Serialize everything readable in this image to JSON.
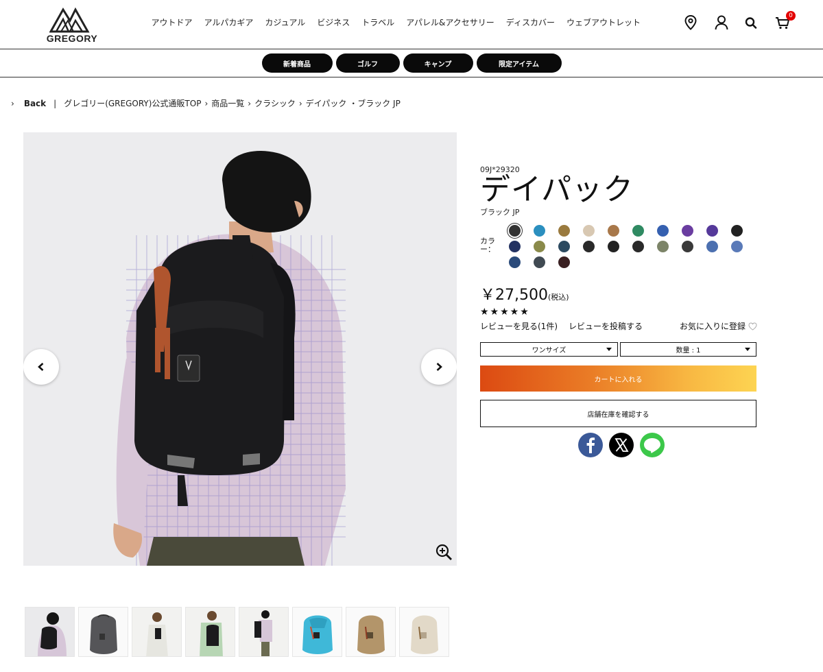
{
  "brand": {
    "name": "GREGORY"
  },
  "nav": {
    "items": [
      "アウトドア",
      "アルパカギア",
      "カジュアル",
      "ビジネス",
      "トラベル",
      "アパレル&アクセサリー",
      "ディスカバー",
      "ウェブアウトレット"
    ]
  },
  "header_icons": [
    "location-icon",
    "account-icon",
    "search-icon",
    "cart-icon"
  ],
  "cart": {
    "count": "0"
  },
  "subnav": {
    "pills": [
      "新着商品",
      "ゴルフ",
      "キャンプ",
      "限定アイテム"
    ]
  },
  "breadcrumb": {
    "back": "Back",
    "sep": "|",
    "crumbs": [
      "グレゴリー(GREGORY)公式通販TOP",
      "商品一覧",
      "クラシック",
      "デイパック ・ブラック JP"
    ],
    "arrow": "›"
  },
  "product": {
    "sku": "09J*29320",
    "title": "デイパック",
    "color_name": "ブラック JP",
    "color_label": "カラー：",
    "swatch_colors": [
      [
        "#333333",
        "#2b8fbf",
        "#9a7a3e",
        "#d8c8b2",
        "#a8784a",
        "#2f8a62",
        "#3560b0",
        "#6a3da0",
        "#55399a",
        "#222222"
      ],
      [
        "#233262",
        "#8a8a4a",
        "#2c4a60",
        "#2a2a2a",
        "#222222",
        "#2a2a2a",
        "#7c8468",
        "#3a3a3a",
        "#4c70b0",
        "#5a7ab8"
      ],
      [
        "#2a4a7a",
        "#404a52",
        "#3a2022"
      ]
    ],
    "price": "￥27,500",
    "tax_label": "(税込)",
    "rating": 5,
    "stars": "★★★★★",
    "review_link": "レビューを見る(1件)",
    "post_review": "レビューを投稿する",
    "favorite": "お気に入りに登録",
    "size_select": "ワンサイズ",
    "qty_select": "数量 : 1",
    "add_to_cart": "カートに入れる",
    "check_stock": "店舗在庫を確認する"
  },
  "share": {
    "icons": [
      "facebook-icon",
      "x-icon",
      "line-icon"
    ],
    "line_text": "LINE"
  },
  "thumbnails": 8,
  "colors": {
    "accent_start": "#dc4a12",
    "accent_end": "#fdd452",
    "cart_badge": "#e30000",
    "facebook": "#3b5998",
    "line": "#3cc84a"
  }
}
